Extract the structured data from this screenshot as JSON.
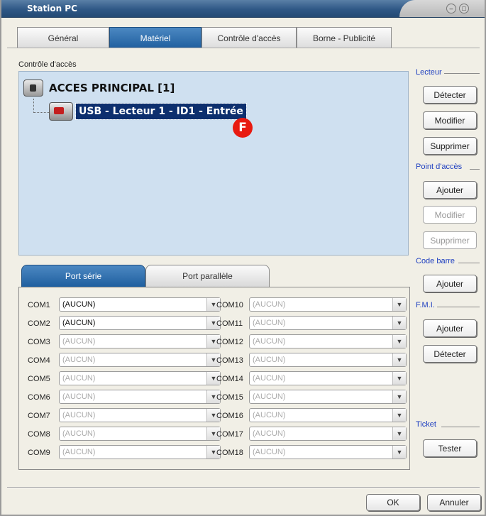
{
  "window": {
    "title": "Station PC"
  },
  "tabs": [
    {
      "label": "Général",
      "active": false
    },
    {
      "label": "Matériel",
      "active": true
    },
    {
      "label": "Contrôle d'accès",
      "active": false
    },
    {
      "label": "Borne - Publicité",
      "active": false
    }
  ],
  "access_control": {
    "group_label": "Contrôle d'accès",
    "root_label": "ACCES PRINCIPAL [1]",
    "child_label": "USB - Lecteur 1 - ID1 - Entrée",
    "badge": "F"
  },
  "port_tabs": [
    {
      "label": "Port série",
      "active": true
    },
    {
      "label": "Port parallèle",
      "active": false
    }
  ],
  "com_ports_left": [
    {
      "label": "COM1",
      "value": "(AUCUN)",
      "enabled": true
    },
    {
      "label": "COM2",
      "value": "(AUCUN)",
      "enabled": true
    },
    {
      "label": "COM3",
      "value": "(AUCUN)",
      "enabled": false
    },
    {
      "label": "COM4",
      "value": "(AUCUN)",
      "enabled": false
    },
    {
      "label": "COM5",
      "value": "(AUCUN)",
      "enabled": false
    },
    {
      "label": "COM6",
      "value": "(AUCUN)",
      "enabled": false
    },
    {
      "label": "COM7",
      "value": "(AUCUN)",
      "enabled": false
    },
    {
      "label": "COM8",
      "value": "(AUCUN)",
      "enabled": false
    },
    {
      "label": "COM9",
      "value": "(AUCUN)",
      "enabled": false
    }
  ],
  "com_ports_right": [
    {
      "label": "COM10",
      "value": "(AUCUN)",
      "enabled": false
    },
    {
      "label": "COM11",
      "value": "(AUCUN)",
      "enabled": false
    },
    {
      "label": "COM12",
      "value": "(AUCUN)",
      "enabled": false
    },
    {
      "label": "COM13",
      "value": "(AUCUN)",
      "enabled": false
    },
    {
      "label": "COM14",
      "value": "(AUCUN)",
      "enabled": false
    },
    {
      "label": "COM15",
      "value": "(AUCUN)",
      "enabled": false
    },
    {
      "label": "COM16",
      "value": "(AUCUN)",
      "enabled": false
    },
    {
      "label": "COM17",
      "value": "(AUCUN)",
      "enabled": false
    },
    {
      "label": "COM18",
      "value": "(AUCUN)",
      "enabled": false
    }
  ],
  "side": {
    "lecteur": {
      "header": "Lecteur",
      "detect": "Détecter",
      "modify": "Modifier",
      "delete": "Supprimer"
    },
    "point_acces": {
      "header": "Point d'accès",
      "add": "Ajouter",
      "modify": "Modifier",
      "delete": "Supprimer"
    },
    "code_barre": {
      "header": "Code barre",
      "add": "Ajouter"
    },
    "fmi": {
      "header": "F.M.I.",
      "add": "Ajouter",
      "detect": "Détecter"
    },
    "ticket": {
      "header": "Ticket",
      "test": "Tester"
    }
  },
  "footer": {
    "ok": "OK",
    "cancel": "Annuler"
  },
  "colors": {
    "title_bar": "#2f5886",
    "active_tab": "#1f5f9f",
    "selection": "#0d2f6e",
    "link": "#1e3fc0",
    "badge": "#e81a10"
  }
}
